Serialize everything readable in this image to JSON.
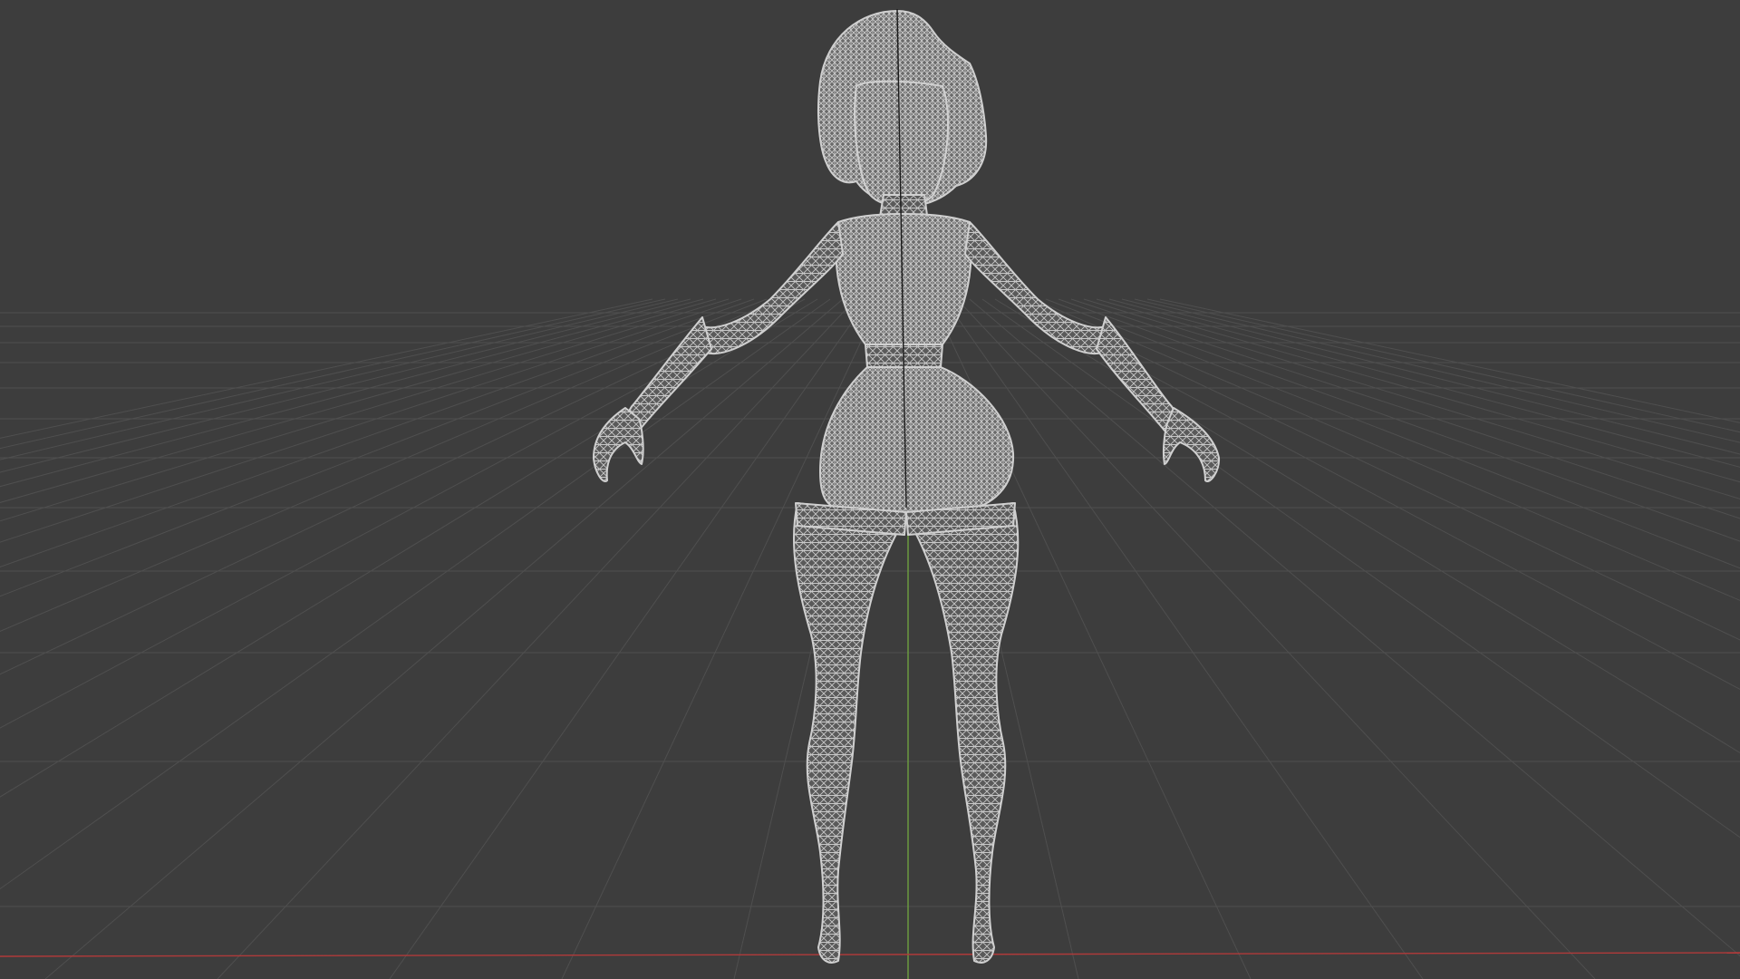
{
  "viewport": {
    "mode": "wireframe",
    "view": "front-perspective",
    "background_color": "#3d3d3d",
    "grid_color": "#4f4f4f",
    "wire_color": "#c8c8c8",
    "axis_x_color": "#b03a3a",
    "axis_y_color": "#6ea040",
    "axis_z_color": "#1b1b1b",
    "grid_visible": true
  },
  "object": {
    "type": "character-mesh",
    "display": "wireframe"
  }
}
